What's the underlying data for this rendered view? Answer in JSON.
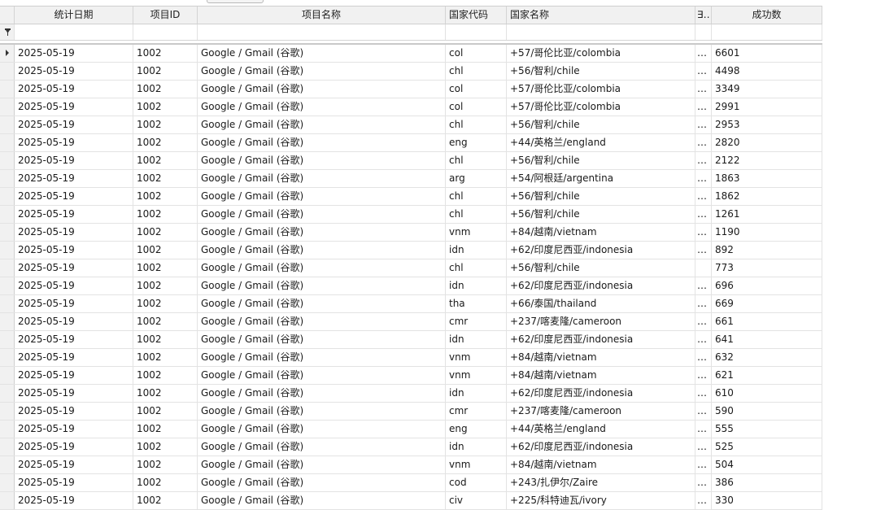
{
  "columns": {
    "date": "统计日期",
    "project_id": "项目ID",
    "project_name": "项目名称",
    "country_code": "国家代码",
    "country_name": "国家名称",
    "truncated": "∃…",
    "success_count": "成功数"
  },
  "rows": [
    {
      "date": "2025-05-19",
      "project_id": "1002",
      "project_name": "Google / Gmail (谷歌)",
      "country_code": "col",
      "country_name": "+57/哥伦比亚/colombia",
      "truncated": "…",
      "success_count": "6601"
    },
    {
      "date": "2025-05-19",
      "project_id": "1002",
      "project_name": "Google / Gmail (谷歌)",
      "country_code": "chl",
      "country_name": "+56/智利/chile",
      "truncated": "…",
      "success_count": "4498"
    },
    {
      "date": "2025-05-19",
      "project_id": "1002",
      "project_name": "Google / Gmail (谷歌)",
      "country_code": "col",
      "country_name": "+57/哥伦比亚/colombia",
      "truncated": "…",
      "success_count": "3349"
    },
    {
      "date": "2025-05-19",
      "project_id": "1002",
      "project_name": "Google / Gmail (谷歌)",
      "country_code": "col",
      "country_name": "+57/哥伦比亚/colombia",
      "truncated": "…",
      "success_count": "2991"
    },
    {
      "date": "2025-05-19",
      "project_id": "1002",
      "project_name": "Google / Gmail (谷歌)",
      "country_code": "chl",
      "country_name": "+56/智利/chile",
      "truncated": "…",
      "success_count": "2953"
    },
    {
      "date": "2025-05-19",
      "project_id": "1002",
      "project_name": "Google / Gmail (谷歌)",
      "country_code": "eng",
      "country_name": "+44/英格兰/england",
      "truncated": "…",
      "success_count": "2820"
    },
    {
      "date": "2025-05-19",
      "project_id": "1002",
      "project_name": "Google / Gmail (谷歌)",
      "country_code": "chl",
      "country_name": "+56/智利/chile",
      "truncated": "…",
      "success_count": "2122"
    },
    {
      "date": "2025-05-19",
      "project_id": "1002",
      "project_name": "Google / Gmail (谷歌)",
      "country_code": "arg",
      "country_name": "+54/阿根廷/argentina",
      "truncated": "…",
      "success_count": "1863"
    },
    {
      "date": "2025-05-19",
      "project_id": "1002",
      "project_name": "Google / Gmail (谷歌)",
      "country_code": "chl",
      "country_name": "+56/智利/chile",
      "truncated": "…",
      "success_count": "1862"
    },
    {
      "date": "2025-05-19",
      "project_id": "1002",
      "project_name": "Google / Gmail (谷歌)",
      "country_code": "chl",
      "country_name": "+56/智利/chile",
      "truncated": "…",
      "success_count": "1261"
    },
    {
      "date": "2025-05-19",
      "project_id": "1002",
      "project_name": "Google / Gmail (谷歌)",
      "country_code": "vnm",
      "country_name": "+84/越南/vietnam",
      "truncated": "…",
      "success_count": "1190"
    },
    {
      "date": "2025-05-19",
      "project_id": "1002",
      "project_name": "Google / Gmail (谷歌)",
      "country_code": "idn",
      "country_name": "+62/印度尼西亚/indonesia",
      "truncated": "…",
      "success_count": "892"
    },
    {
      "date": "2025-05-19",
      "project_id": "1002",
      "project_name": "Google / Gmail (谷歌)",
      "country_code": "chl",
      "country_name": "+56/智利/chile",
      "truncated": "",
      "success_count": "773"
    },
    {
      "date": "2025-05-19",
      "project_id": "1002",
      "project_name": "Google / Gmail (谷歌)",
      "country_code": "idn",
      "country_name": "+62/印度尼西亚/indonesia",
      "truncated": "…",
      "success_count": "696"
    },
    {
      "date": "2025-05-19",
      "project_id": "1002",
      "project_name": "Google / Gmail (谷歌)",
      "country_code": "tha",
      "country_name": "+66/泰国/thailand",
      "truncated": "…",
      "success_count": "669"
    },
    {
      "date": "2025-05-19",
      "project_id": "1002",
      "project_name": "Google / Gmail (谷歌)",
      "country_code": "cmr",
      "country_name": "+237/喀麦隆/cameroon",
      "truncated": "…",
      "success_count": "661"
    },
    {
      "date": "2025-05-19",
      "project_id": "1002",
      "project_name": "Google / Gmail (谷歌)",
      "country_code": "idn",
      "country_name": "+62/印度尼西亚/indonesia",
      "truncated": "…",
      "success_count": "641"
    },
    {
      "date": "2025-05-19",
      "project_id": "1002",
      "project_name": "Google / Gmail (谷歌)",
      "country_code": "vnm",
      "country_name": "+84/越南/vietnam",
      "truncated": "…",
      "success_count": "632"
    },
    {
      "date": "2025-05-19",
      "project_id": "1002",
      "project_name": "Google / Gmail (谷歌)",
      "country_code": "vnm",
      "country_name": "+84/越南/vietnam",
      "truncated": "…",
      "success_count": "621"
    },
    {
      "date": "2025-05-19",
      "project_id": "1002",
      "project_name": "Google / Gmail (谷歌)",
      "country_code": "idn",
      "country_name": "+62/印度尼西亚/indonesia",
      "truncated": "…",
      "success_count": "610"
    },
    {
      "date": "2025-05-19",
      "project_id": "1002",
      "project_name": "Google / Gmail (谷歌)",
      "country_code": "cmr",
      "country_name": "+237/喀麦隆/cameroon",
      "truncated": "…",
      "success_count": "590"
    },
    {
      "date": "2025-05-19",
      "project_id": "1002",
      "project_name": "Google / Gmail (谷歌)",
      "country_code": "eng",
      "country_name": "+44/英格兰/england",
      "truncated": "…",
      "success_count": "555"
    },
    {
      "date": "2025-05-19",
      "project_id": "1002",
      "project_name": "Google / Gmail (谷歌)",
      "country_code": "idn",
      "country_name": "+62/印度尼西亚/indonesia",
      "truncated": "…",
      "success_count": "525"
    },
    {
      "date": "2025-05-19",
      "project_id": "1002",
      "project_name": "Google / Gmail (谷歌)",
      "country_code": "vnm",
      "country_name": "+84/越南/vietnam",
      "truncated": "…",
      "success_count": "504"
    },
    {
      "date": "2025-05-19",
      "project_id": "1002",
      "project_name": "Google / Gmail (谷歌)",
      "country_code": "cod",
      "country_name": "+243/扎伊尔/Zaire",
      "truncated": "…",
      "success_count": "386"
    },
    {
      "date": "2025-05-19",
      "project_id": "1002",
      "project_name": "Google / Gmail (谷歌)",
      "country_code": "civ",
      "country_name": "+225/科特迪瓦/ivory",
      "truncated": "…",
      "success_count": "330"
    }
  ]
}
